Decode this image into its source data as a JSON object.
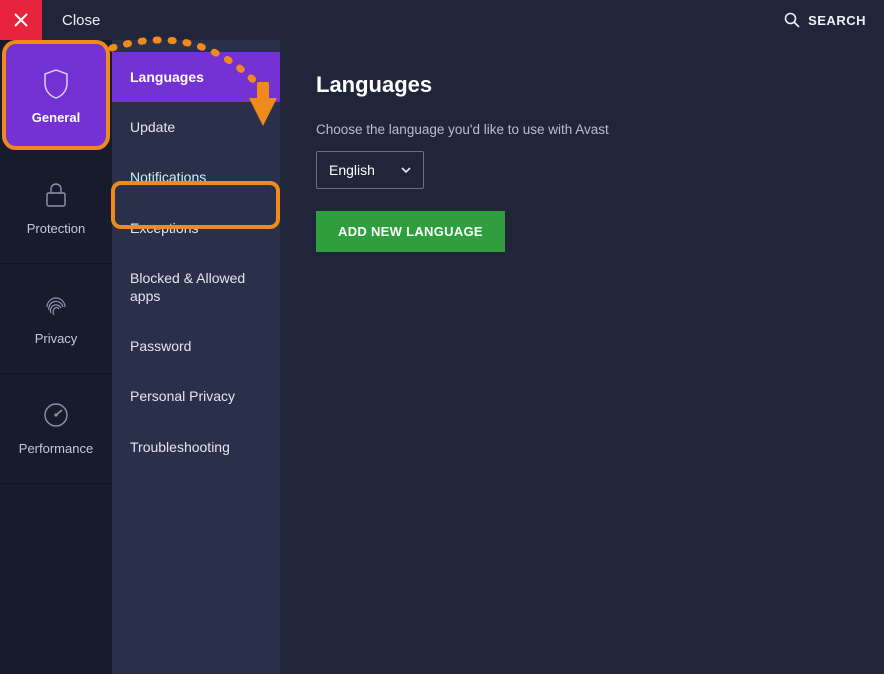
{
  "topbar": {
    "close_label": "Close",
    "search_label": "SEARCH"
  },
  "sidebar_primary": {
    "items": [
      {
        "label": "General",
        "active": true
      },
      {
        "label": "Protection",
        "active": false
      },
      {
        "label": "Privacy",
        "active": false
      },
      {
        "label": "Performance",
        "active": false
      }
    ]
  },
  "sidebar_secondary": {
    "items": [
      {
        "label": "Languages",
        "active": true
      },
      {
        "label": "Update",
        "active": false
      },
      {
        "label": "Notifications",
        "active": false,
        "highlighted": true
      },
      {
        "label": "Exceptions",
        "active": false
      },
      {
        "label": "Blocked & Allowed apps",
        "active": false
      },
      {
        "label": "Password",
        "active": false
      },
      {
        "label": "Personal Privacy",
        "active": false
      },
      {
        "label": "Troubleshooting",
        "active": false
      }
    ]
  },
  "main": {
    "title": "Languages",
    "description": "Choose the language you'd like to use with Avast",
    "selected_language": "English",
    "add_button_label": "ADD NEW LANGUAGE"
  },
  "colors": {
    "accent_purple": "#7432d4",
    "highlight_orange": "#f08a1c",
    "close_red": "#e8233d",
    "button_green": "#2f9e3f"
  }
}
